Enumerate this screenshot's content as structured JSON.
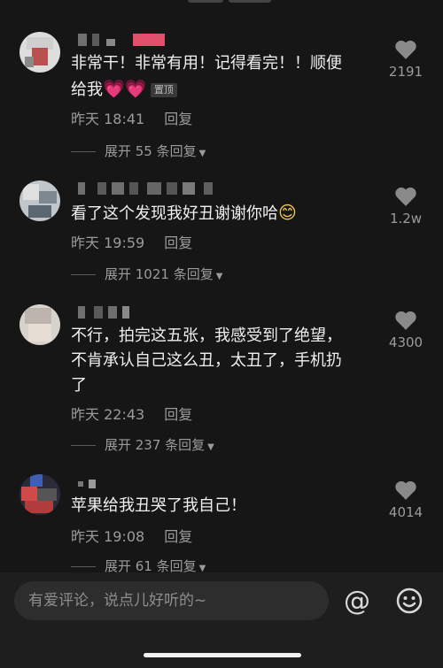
{
  "comments": [
    {
      "text_parts": [
        "非常干！非常有用！记得看完！！顺便",
        "给我"
      ],
      "emoji_hearts": "💗💗",
      "pinned_label": "置顶",
      "time": "昨天 18:41",
      "reply_label": "回复",
      "expand_label": "展开 55 条回复",
      "likes": "2191"
    },
    {
      "text": "看了这个发现我好丑谢谢你哈",
      "emoji_smile": "😊",
      "time": "昨天 19:59",
      "reply_label": "回复",
      "expand_label": "展开 1021 条回复",
      "likes": "1.2w"
    },
    {
      "text_lines": [
        "不行，拍完这五张，我感受到了绝望，",
        "不肯承认自己这么丑，太丑了，手机扔",
        "了"
      ],
      "time": "昨天 22:43",
      "reply_label": "回复",
      "expand_label": "展开 237 条回复",
      "likes": "4300"
    },
    {
      "text": "苹果给我丑哭了我自己！",
      "time": "昨天 19:08",
      "reply_label": "回复",
      "expand_label": "展开 61 条回复",
      "likes": "4014"
    }
  ],
  "composer": {
    "placeholder": "有爱评论，说点儿好听的~",
    "at_symbol": "@"
  },
  "colors": {
    "background": "#161616",
    "bottom_bar": "#1e1e1e",
    "input": "#2d2d2d",
    "text": "#f0f0f0",
    "muted": "#9b9b9b"
  }
}
